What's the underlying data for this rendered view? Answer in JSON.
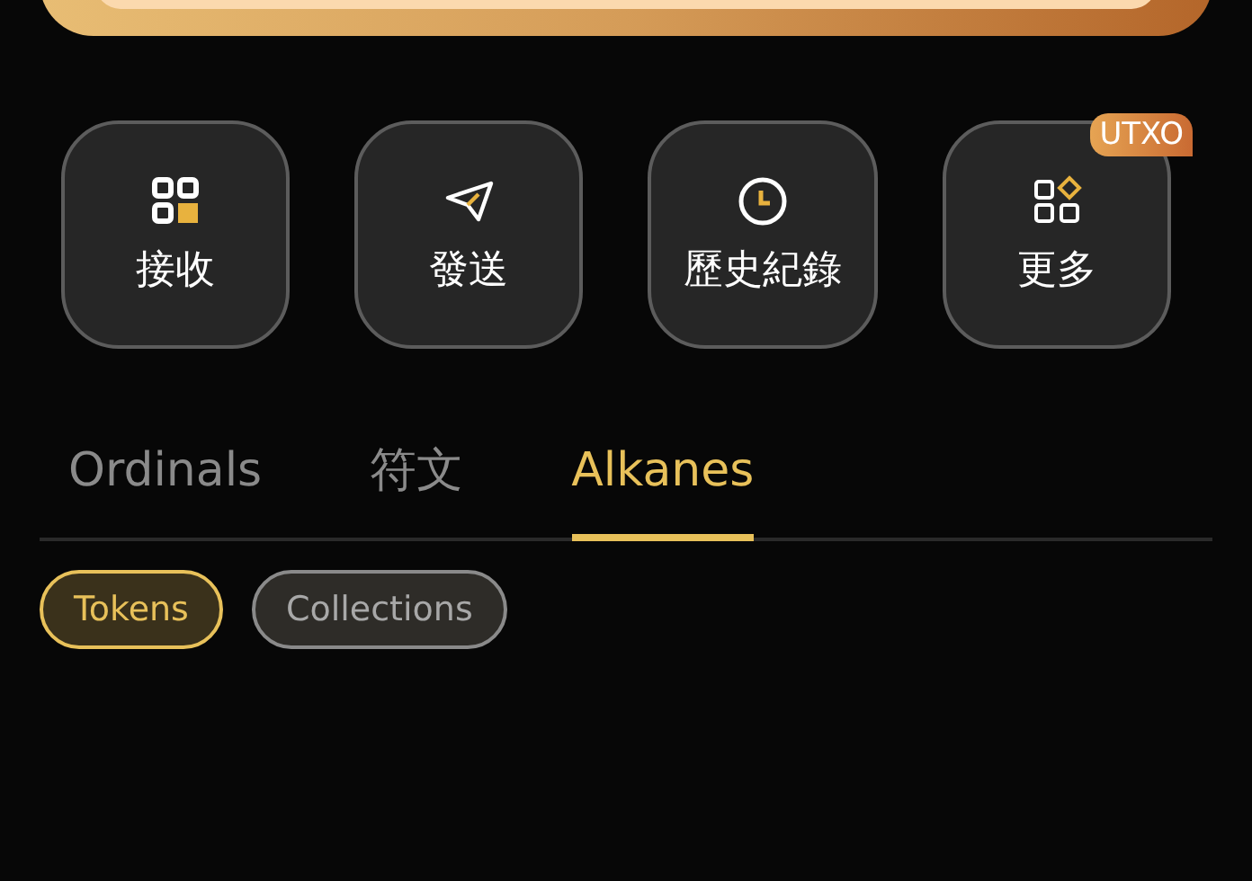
{
  "actions": [
    {
      "label": "接收",
      "kind": "receive"
    },
    {
      "label": "發送",
      "kind": "send"
    },
    {
      "label": "歷史紀錄",
      "kind": "history"
    },
    {
      "label": "更多",
      "kind": "more",
      "badge": "UTXO"
    }
  ],
  "tabs": [
    {
      "label": "Ordinals",
      "selected": false
    },
    {
      "label": "符文",
      "selected": false
    },
    {
      "label": "Alkanes",
      "selected": true
    }
  ],
  "filters": [
    {
      "label": "Tokens",
      "selected": true
    },
    {
      "label": "Collections",
      "selected": false
    }
  ]
}
